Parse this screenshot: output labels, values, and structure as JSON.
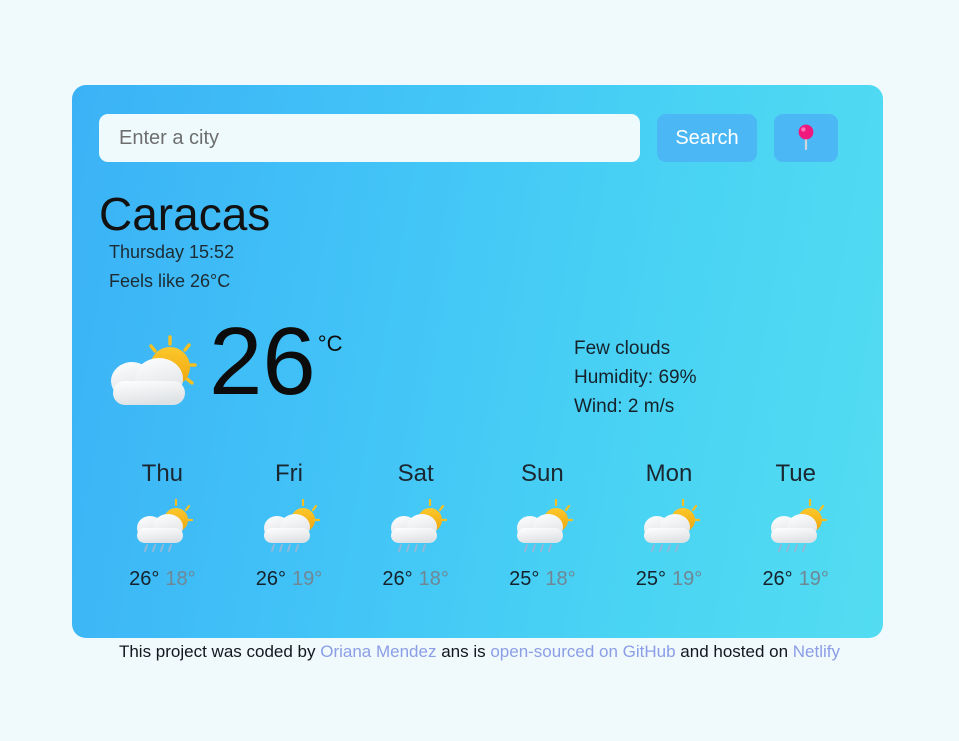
{
  "search": {
    "placeholder": "Enter a city",
    "value": "",
    "button_label": "Search",
    "pin_icon": "round-pushpin-icon"
  },
  "current": {
    "city": "Caracas",
    "datetime": "Thursday 15:52",
    "feels_like": "Feels like 26°C",
    "icon": "sun-behind-cloud-icon",
    "temperature": "26",
    "unit": "°C",
    "description": "Few clouds",
    "humidity": "Humidity: 69%",
    "wind": "Wind: 2 m/s"
  },
  "forecast": [
    {
      "day": "Thu",
      "icon": "sun-behind-rain-cloud-icon",
      "max": "26°",
      "min": "18°"
    },
    {
      "day": "Fri",
      "icon": "sun-behind-rain-cloud-icon",
      "max": "26°",
      "min": "19°"
    },
    {
      "day": "Sat",
      "icon": "sun-behind-rain-cloud-icon",
      "max": "26°",
      "min": "18°"
    },
    {
      "day": "Sun",
      "icon": "sun-behind-rain-cloud-icon",
      "max": "25°",
      "min": "18°"
    },
    {
      "day": "Mon",
      "icon": "sun-behind-rain-cloud-icon",
      "max": "25°",
      "min": "19°"
    },
    {
      "day": "Tue",
      "icon": "sun-behind-rain-cloud-icon",
      "max": "26°",
      "min": "19°"
    }
  ],
  "footer": {
    "text_1": "This project was coded by ",
    "link_author": "Oriana Mendez",
    "text_2": " ans is ",
    "link_github": "open-sourced on GitHub",
    "text_3": " and hosted on ",
    "link_netlify": "Netlify"
  },
  "colors": {
    "page_background": "#f0f9fb",
    "card_gradient_start": "#3bb2f6",
    "card_gradient_end": "#53dcf1",
    "button_blue": "#4cb7f5",
    "link_blue": "#8b9ee7",
    "pin_pink": "#f0197d"
  }
}
